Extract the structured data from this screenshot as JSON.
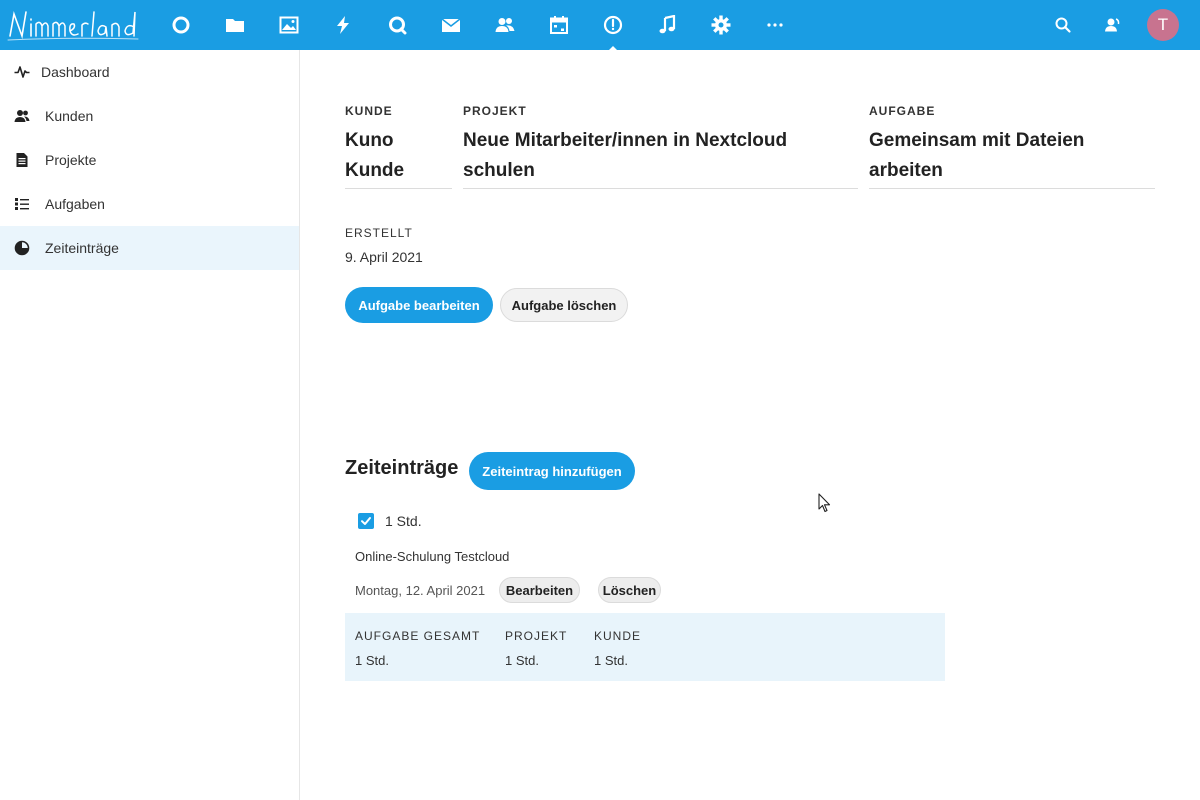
{
  "header": {
    "logo_text": "Nimmerland",
    "apps": [
      {
        "icon": "dashboard-circle-icon"
      },
      {
        "icon": "folder-icon"
      },
      {
        "icon": "image-icon"
      },
      {
        "icon": "activity-bolt-icon"
      },
      {
        "icon": "talk-search-icon"
      },
      {
        "icon": "mail-icon"
      },
      {
        "icon": "contacts-icon"
      },
      {
        "icon": "calendar-icon"
      },
      {
        "icon": "clock-icon"
      },
      {
        "icon": "music-icon"
      },
      {
        "icon": "gear-icon"
      },
      {
        "icon": "more-icon"
      }
    ],
    "avatar_initial": "T",
    "avatar_color": "#c8738f",
    "accent_color": "#1a9de3"
  },
  "sidebar": {
    "items": [
      {
        "label": "Dashboard",
        "icon": "pulse-icon"
      },
      {
        "label": "Kunden",
        "icon": "users-icon"
      },
      {
        "label": "Projekte",
        "icon": "document-icon"
      },
      {
        "label": "Aufgaben",
        "icon": "list-icon"
      },
      {
        "label": "Zeiteinträge",
        "icon": "pie-clock-icon",
        "active": true
      }
    ]
  },
  "task": {
    "kunde_label": "KUNDE",
    "kunde_value": "Kuno Kunde",
    "projekt_label": "PROJEKT",
    "projekt_value": "Neue Mitarbeiter/innen in Nextcloud schulen",
    "aufgabe_label": "AUFGABE",
    "aufgabe_value": "Gemeinsam mit Dateien arbeiten",
    "erstellt_label": "ERSTELLT",
    "erstellt_value": "9. April 2021",
    "edit_label": "Aufgabe bearbeiten",
    "delete_label": "Aufgabe löschen"
  },
  "entries": {
    "title": "Zeiteinträge",
    "add_label": "Zeiteintrag hinzufügen",
    "items": [
      {
        "duration": "1 Std.",
        "checked": true,
        "description": "Online-Schulung Testcloud",
        "date": "Montag, 12. April 2021",
        "edit_label": "Bearbeiten",
        "delete_label": "Löschen"
      }
    ],
    "summary": {
      "aufgabe_label": "AUFGABE GESAMT",
      "aufgabe_value": "1 Std.",
      "projekt_label": "PROJEKT",
      "projekt_value": "1 Std.",
      "kunde_label": "KUNDE",
      "kunde_value": "1 Std."
    }
  }
}
